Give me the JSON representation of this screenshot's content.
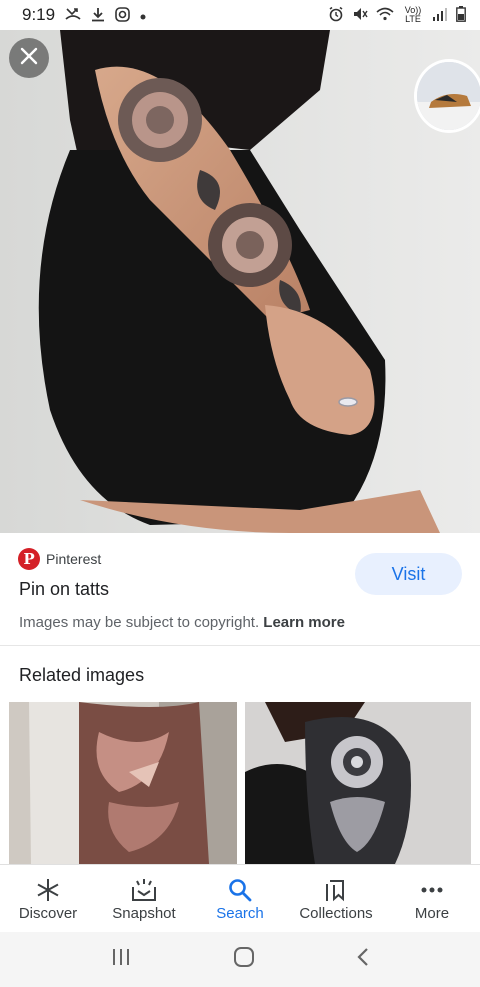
{
  "status_bar": {
    "time": "9:19",
    "left_icons": [
      "missed-call-icon",
      "download-icon",
      "instagram-icon",
      "dot-icon"
    ],
    "right_icons": [
      "alarm-icon",
      "mute-icon",
      "wifi-icon",
      "volte-icon",
      "signal-icon",
      "battery-icon"
    ],
    "volte_label": "Vo)) LTE"
  },
  "hero": {
    "close_icon": "close-icon",
    "thumbnail_icon": "related-thumbnail"
  },
  "result": {
    "source": "Pinterest",
    "source_logo_letter": "P",
    "title": "Pin on tatts",
    "visit_label": "Visit",
    "copyright_text": "Images may be subject to copyright.",
    "learn_more": "Learn more"
  },
  "related": {
    "heading": "Related images"
  },
  "bottom_nav": {
    "items": [
      {
        "label": "Discover",
        "icon": "asterisk-icon",
        "active": false
      },
      {
        "label": "Snapshot",
        "icon": "snapshot-icon",
        "active": false
      },
      {
        "label": "Search",
        "icon": "search-icon",
        "active": true
      },
      {
        "label": "Collections",
        "icon": "bookmark-icon",
        "active": false
      },
      {
        "label": "More",
        "icon": "more-dots-icon",
        "active": false
      }
    ]
  },
  "system_nav": [
    "recents-icon",
    "home-icon",
    "back-icon"
  ],
  "colors": {
    "accent": "#1a73e8",
    "visit_bg": "#e8f0fe",
    "pinterest": "#d42027"
  }
}
